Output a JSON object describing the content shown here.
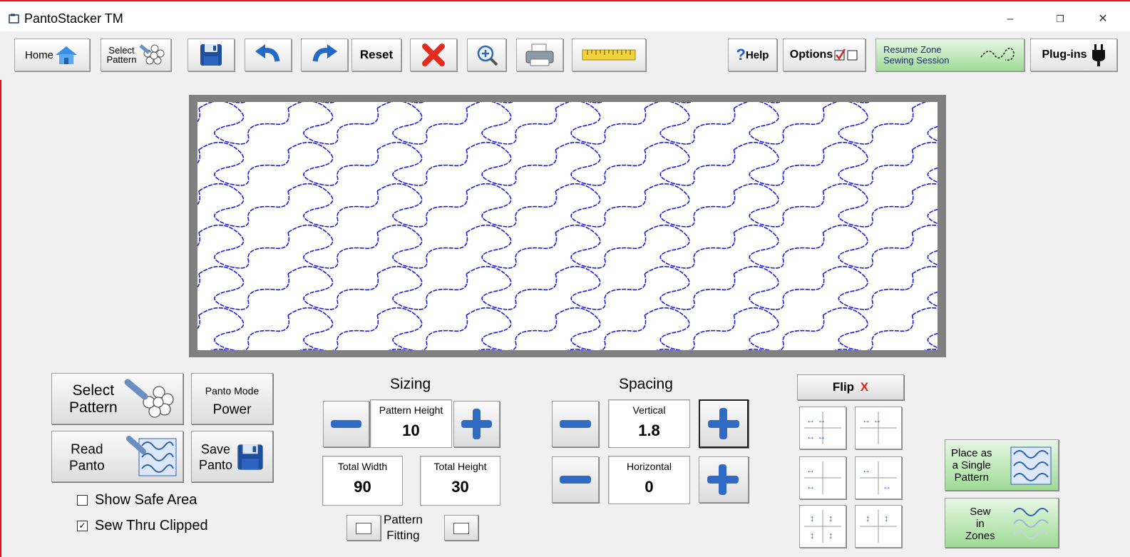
{
  "window": {
    "title": "PantoStacker TM",
    "minimize": "–",
    "restore": "❐",
    "close": "✕"
  },
  "toolbar": {
    "home": "Home",
    "select_pattern_line1": "Select",
    "select_pattern_line2": "Pattern",
    "reset": "Reset",
    "help": "Help",
    "help_q": "?",
    "options": "Options",
    "resume_line1": "Resume Zone",
    "resume_line2": "Sewing Session",
    "plugins": "Plug-ins"
  },
  "left_panel": {
    "select_line1": "Select",
    "select_line2": "Pattern",
    "panto_mode_label": "Panto Mode",
    "panto_mode_value": "Power",
    "read_line1": "Read",
    "read_line2": "Panto",
    "save_line1": "Save",
    "save_line2": "Panto",
    "show_safe_area": "Show Safe Area",
    "show_safe_area_checked": false,
    "sew_thru_clipped": "Sew Thru Clipped",
    "sew_thru_clipped_checked": true
  },
  "sizing": {
    "heading": "Sizing",
    "pattern_height_label": "Pattern Height",
    "pattern_height": "10",
    "total_width_label": "Total Width",
    "total_width": "90",
    "total_height_label": "Total Height",
    "total_height": "30",
    "fitting_line1": "Pattern",
    "fitting_line2": "Fitting"
  },
  "spacing": {
    "heading": "Spacing",
    "vertical_label": "Vertical",
    "vertical": "1.8",
    "horizontal_label": "Horizontal",
    "horizontal": "0"
  },
  "arrangement": {
    "flip": "Flip",
    "flip_mark": "X",
    "place_line1": "Place as",
    "place_line2": "a Single",
    "place_line3": "Pattern",
    "sew_line1": "Sew",
    "sew_line2": "in",
    "sew_line3": "Zones"
  },
  "colors": {
    "stitch": "#1d1ddc",
    "frame": "#808080",
    "accent_red": "#e81123",
    "flip_x": "#e02020",
    "green": "#9fdb96"
  },
  "pattern": {
    "columns": 9,
    "rows": 6
  }
}
